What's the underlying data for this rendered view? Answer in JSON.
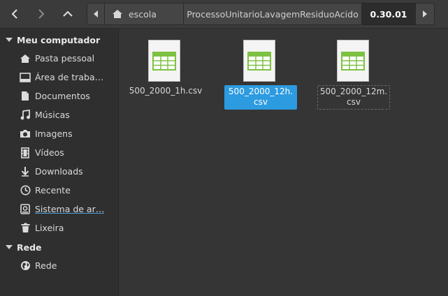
{
  "toolbar": {
    "back_icon": "chevron-left-icon",
    "forward_icon": "chevron-right-icon",
    "up_icon": "chevron-up-icon"
  },
  "pathbar": {
    "home_label": "escola",
    "folder_label": "ProcessoUnitarioLavagemResiduoAcido",
    "current_label": "0.30.01"
  },
  "sidebar": {
    "section_computer": "Meu computador",
    "items": [
      {
        "label": "Pasta pessoal",
        "icon": "home-icon"
      },
      {
        "label": "Área de traba…",
        "icon": "desktop-icon"
      },
      {
        "label": "Documentos",
        "icon": "document-icon"
      },
      {
        "label": "Músicas",
        "icon": "music-icon"
      },
      {
        "label": "Imagens",
        "icon": "camera-icon"
      },
      {
        "label": "Vídeos",
        "icon": "film-icon"
      },
      {
        "label": "Downloads",
        "icon": "download-icon"
      },
      {
        "label": "Recente",
        "icon": "clock-icon"
      },
      {
        "label": "Sistema de ar…",
        "icon": "drive-icon"
      },
      {
        "label": "Lixeira",
        "icon": "trash-icon"
      }
    ],
    "section_network": "Rede",
    "network_items": [
      {
        "label": "Rede",
        "icon": "globe-icon"
      }
    ]
  },
  "files": [
    {
      "name": "500_2000_1h.csv",
      "state": "normal"
    },
    {
      "name": "500_2000_12h.\ncsv",
      "line1": "500_2000_12h.",
      "line2": "csv",
      "state": "selected"
    },
    {
      "name": "500_2000_12m.\ncsv",
      "line1": "500_2000_12m.",
      "line2": "csv",
      "state": "focused"
    }
  ],
  "colors": {
    "selection": "#2d9be0",
    "spreadsheet_icon": "#7dc242"
  }
}
